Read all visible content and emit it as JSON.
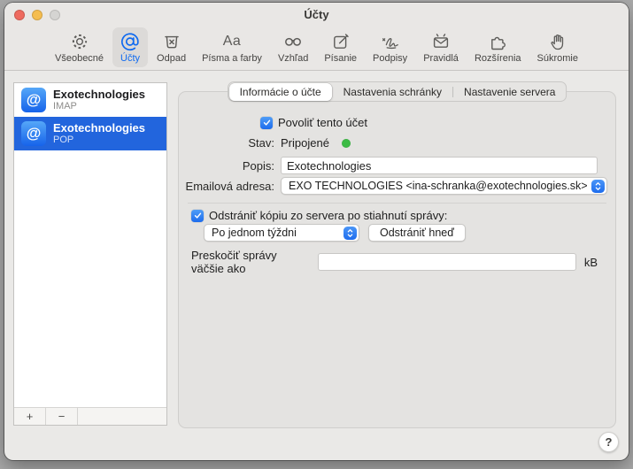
{
  "window": {
    "title": "Účty"
  },
  "toolbar": {
    "items": [
      {
        "label": "Všeobecné",
        "icon": "gear-icon",
        "selected": false
      },
      {
        "label": "Účty",
        "icon": "at-icon",
        "selected": true
      },
      {
        "label": "Odpad",
        "icon": "trash-icon",
        "selected": false
      },
      {
        "label": "Písma a farby",
        "icon": "fonts-icon",
        "selected": false
      },
      {
        "label": "Vzhľad",
        "icon": "glasses-icon",
        "selected": false
      },
      {
        "label": "Písanie",
        "icon": "compose-icon",
        "selected": false
      },
      {
        "label": "Podpisy",
        "icon": "signature-icon",
        "selected": false
      },
      {
        "label": "Pravidlá",
        "icon": "rules-envelope-icon",
        "selected": false
      },
      {
        "label": "Rozšírenia",
        "icon": "puzzle-icon",
        "selected": false
      },
      {
        "label": "Súkromie",
        "icon": "hand-icon",
        "selected": false
      }
    ]
  },
  "sidebar": {
    "accounts": [
      {
        "name": "Exotechnologies",
        "type": "IMAP",
        "selected": false
      },
      {
        "name": "Exotechnologies",
        "type": "POP",
        "selected": true
      }
    ],
    "add_label": "+",
    "remove_label": "−"
  },
  "tabs": [
    {
      "label": "Informácie o účte",
      "selected": true
    },
    {
      "label": "Nastavenia schránky",
      "selected": false
    },
    {
      "label": "Nastavenie servera",
      "selected": false
    }
  ],
  "form": {
    "enable_checkbox_label": "Povoliť tento účet",
    "enable_checked": true,
    "status_label": "Stav:",
    "status_value": "Pripojené",
    "description_label": "Popis:",
    "description_value": "Exotechnologies",
    "email_label": "Emailová adresa:",
    "email_value": "EXO TECHNOLOGIES <ina-schranka@exotechnologies.sk>",
    "remove_copy_label": "Odstrániť kópiu zo servera po stiahnutí správy:",
    "remove_copy_checked": true,
    "remove_after_value": "Po jednom týždni",
    "remove_now_label": "Odstrániť hneď",
    "skip_label": "Preskočiť správy väčšie ako",
    "skip_value": "",
    "skip_unit": "kB"
  },
  "help": {
    "label": "?"
  },
  "colors": {
    "accent_blue": "#1d6ced",
    "selection_blue": "#2265dd",
    "toolbar_selected_text": "#0f6af0",
    "status_green": "#3cbb45",
    "window_background": "#eae9e7",
    "panel_background": "#e4e3e1"
  }
}
